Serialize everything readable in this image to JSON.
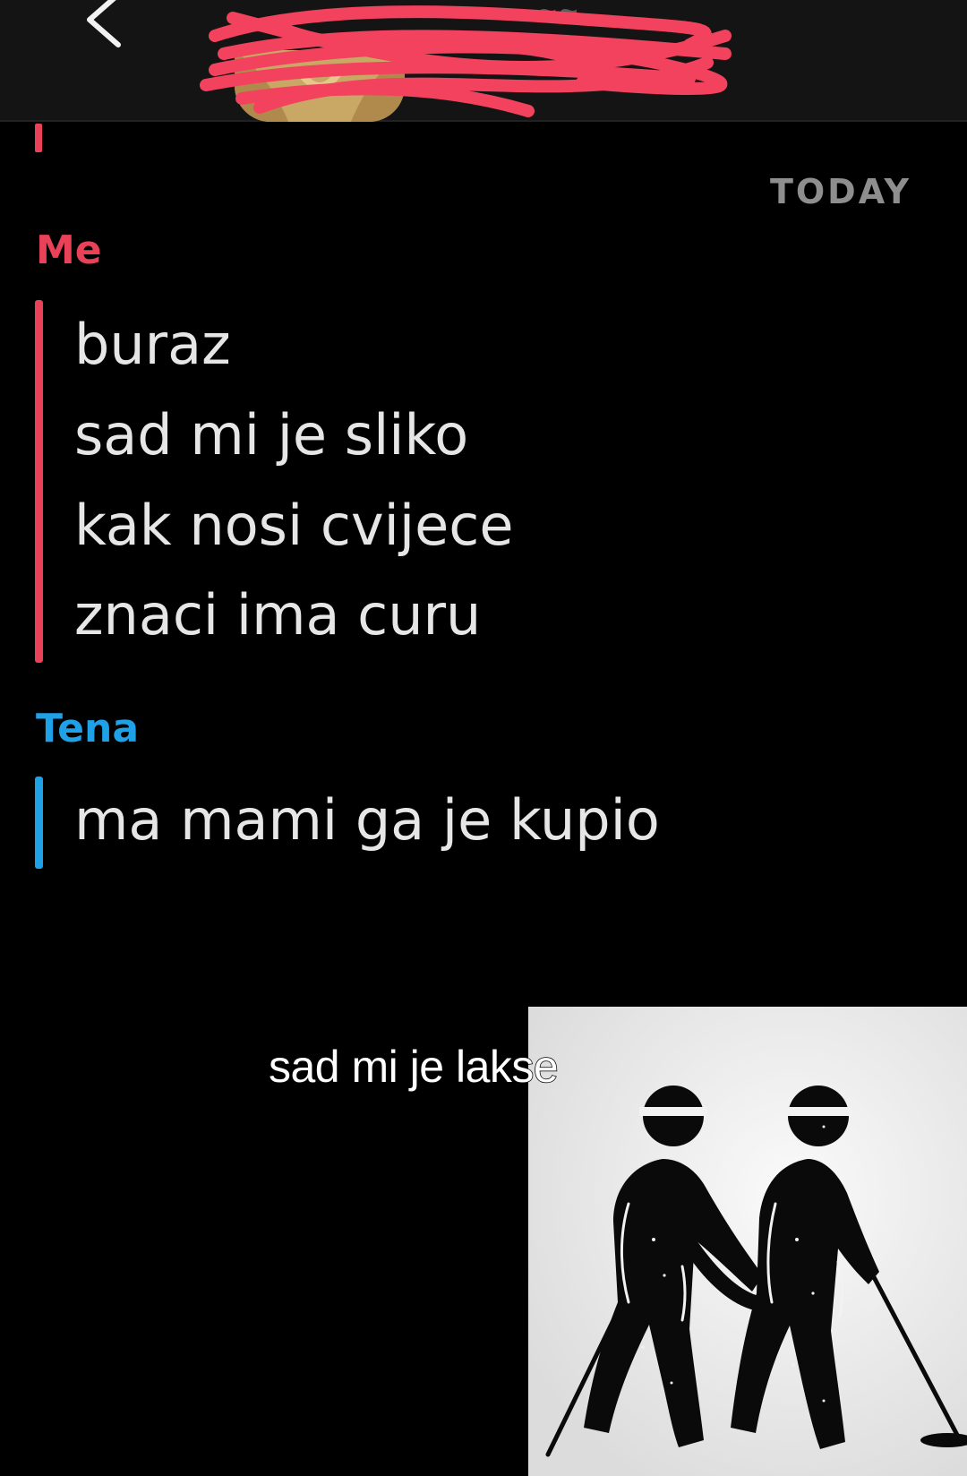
{
  "header": {
    "back_icon": "chevron-left-icon",
    "contact_name_redacted": true
  },
  "chat": {
    "date_divider": "TODAY",
    "groups": [
      {
        "sender": "Me",
        "color": "#e94157",
        "messages": [
          "buraz",
          "sad mi je sliko",
          "kak nosi cvijece",
          "znaci ima curu"
        ]
      },
      {
        "sender": "Tena",
        "color": "#1fa1e8",
        "messages": [
          "ma mami ga je kupio"
        ]
      }
    ]
  },
  "overlay": {
    "caption": "sad mi je lakse",
    "meme_image": "two-blind-men-walking-icon"
  },
  "colors": {
    "background": "#000000",
    "header": "#141414",
    "me_accent": "#e94157",
    "other_accent": "#1fa1e8",
    "date_text": "#8e8e8e"
  }
}
